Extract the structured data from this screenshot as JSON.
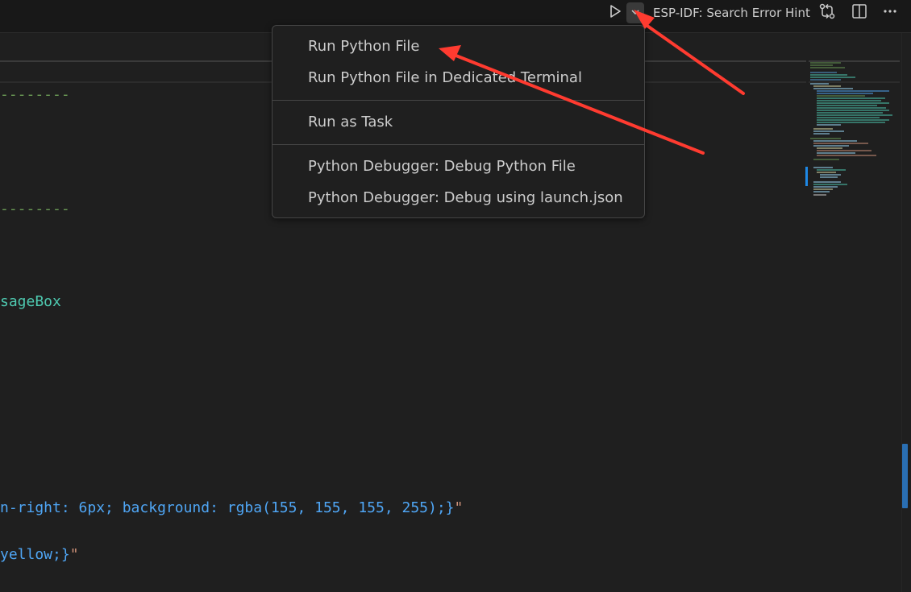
{
  "toolbar": {
    "search_label": "ESP-IDF: Search Error Hint",
    "run_icon": "play-icon",
    "dropdown_icon": "chevron-down-icon",
    "compare_icon": "git-compare-icon",
    "split_icon": "split-editor-icon",
    "more_icon": "more-actions-icon"
  },
  "editor": {
    "lines": [
      {
        "text": "--------"
      },
      {
        "text": "--------"
      },
      {
        "text": "sageBox"
      },
      {
        "text": "n-right: 6px; background: rgba(155, 155, 155, 255);}"
      },
      {
        "text": "yellow;}"
      }
    ],
    "quote": "\""
  },
  "menu": {
    "items": [
      {
        "label": "Run Python File"
      },
      {
        "label": "Run Python File in Dedicated Terminal"
      },
      {
        "label": "Run as Task"
      },
      {
        "label": "Python Debugger: Debug Python File"
      },
      {
        "label": "Python Debugger: Debug using launch.json"
      }
    ]
  },
  "colors": {
    "annotation_arrow": "#ff3b30",
    "comment_green": "#6a9955",
    "type_teal": "#4ec9b0",
    "string_blue": "#4fa6f5"
  }
}
